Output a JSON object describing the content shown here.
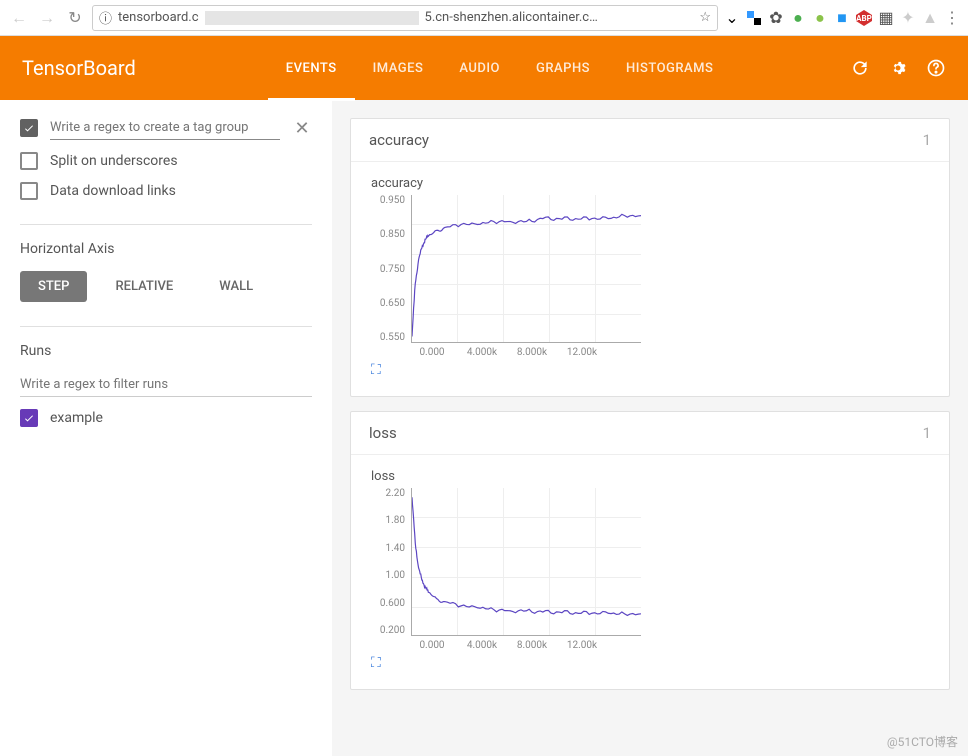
{
  "browser": {
    "url_prefix": "tensorboard.c",
    "url_suffix": "5.cn-shenzhen.alicontainer.c…"
  },
  "header": {
    "logo": "TensorBoard",
    "tabs": [
      "EVENTS",
      "IMAGES",
      "AUDIO",
      "GRAPHS",
      "HISTOGRAMS"
    ],
    "active_tab": 0
  },
  "sidebar": {
    "tag_placeholder": "Write a regex to create a tag group",
    "split_underscores": "Split on underscores",
    "data_download": "Data download links",
    "axis_title": "Horizontal Axis",
    "axis_options": [
      "STEP",
      "RELATIVE",
      "WALL"
    ],
    "axis_active": 0,
    "runs_title": "Runs",
    "runs_filter_placeholder": "Write a regex to filter runs",
    "runs": [
      {
        "name": "example",
        "checked": true
      }
    ]
  },
  "cards": [
    {
      "title": "accuracy",
      "count": "1",
      "charts": [
        {
          "title": "accuracy",
          "key": "accuracy"
        }
      ]
    },
    {
      "title": "loss",
      "count": "1",
      "charts": [
        {
          "title": "loss",
          "key": "loss"
        }
      ]
    }
  ],
  "chart_data": [
    {
      "id": "accuracy",
      "type": "line",
      "title": "accuracy",
      "xlabel": "step",
      "ylabel": "",
      "xlim": [
        0,
        14000
      ],
      "ylim": [
        0.5,
        1.0
      ],
      "xticks": [
        "0.000",
        "4.000k",
        "8.000k",
        "12.00k"
      ],
      "yticks": [
        "0.950",
        "0.850",
        "0.750",
        "0.650",
        "0.550"
      ],
      "series": [
        {
          "name": "example",
          "color": "#5b45c2",
          "x": [
            0,
            200,
            400,
            600,
            800,
            1000,
            1500,
            2000,
            3000,
            4000,
            5000,
            6000,
            7000,
            8000,
            9000,
            10000,
            11000,
            12000,
            13000,
            14000
          ],
          "y": [
            0.52,
            0.7,
            0.78,
            0.82,
            0.85,
            0.86,
            0.88,
            0.89,
            0.9,
            0.9,
            0.91,
            0.91,
            0.91,
            0.92,
            0.92,
            0.92,
            0.92,
            0.92,
            0.93,
            0.93
          ]
        }
      ]
    },
    {
      "id": "loss",
      "type": "line",
      "title": "loss",
      "xlabel": "step",
      "ylabel": "",
      "xlim": [
        0,
        14000
      ],
      "ylim": [
        0,
        2.4
      ],
      "xticks": [
        "0.000",
        "4.000k",
        "8.000k",
        "12.00k"
      ],
      "yticks": [
        "2.20",
        "1.80",
        "1.40",
        "1.00",
        "0.600",
        "0.200"
      ],
      "series": [
        {
          "name": "example",
          "color": "#5b45c2",
          "x": [
            0,
            200,
            400,
            600,
            800,
            1000,
            1500,
            2000,
            3000,
            4000,
            5000,
            6000,
            7000,
            8000,
            9000,
            10000,
            11000,
            12000,
            13000,
            14000
          ],
          "y": [
            2.25,
            1.5,
            1.1,
            0.9,
            0.8,
            0.7,
            0.6,
            0.55,
            0.48,
            0.45,
            0.42,
            0.4,
            0.4,
            0.38,
            0.38,
            0.37,
            0.36,
            0.36,
            0.35,
            0.35
          ]
        }
      ]
    }
  ],
  "watermark": "@51CTO博客"
}
